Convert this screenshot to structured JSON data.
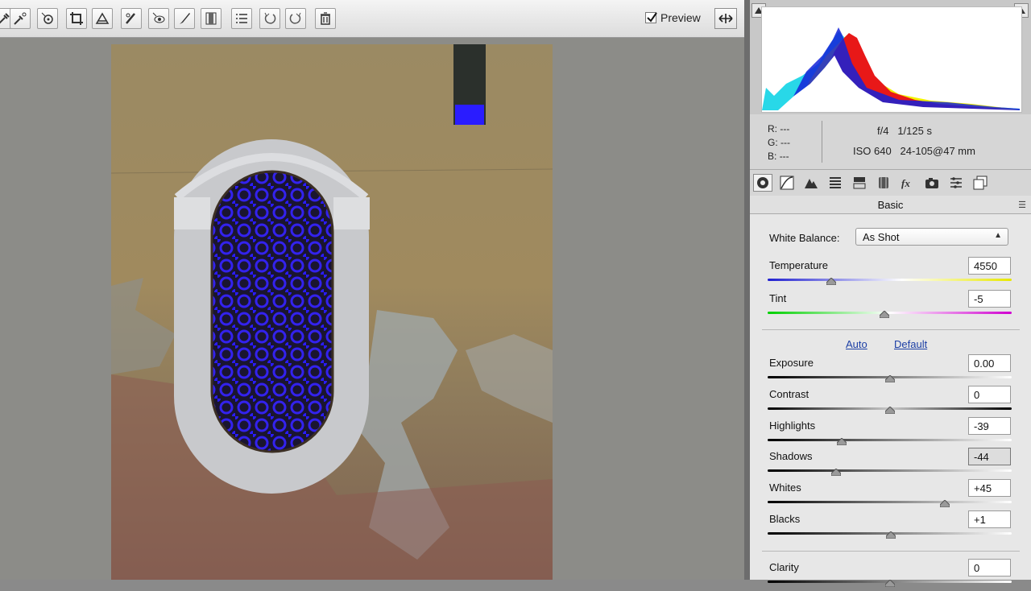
{
  "toolbar": {
    "tools": [
      "white-balance-tool",
      "color-sampler-tool",
      "targeted-adjustment-tool",
      "crop-tool",
      "straighten-tool",
      "spot-removal-tool",
      "red-eye-tool",
      "adjustment-brush-tool",
      "graduated-filter-tool",
      "preferences-button",
      "rotate-ccw-button",
      "rotate-cw-button",
      "delete-button"
    ],
    "preview_label": "Preview",
    "preview_checked": true
  },
  "info": {
    "r_label": "R:",
    "r_value": "---",
    "g_label": "G:",
    "g_value": "---",
    "b_label": "B:",
    "b_value": "---",
    "aperture": "f/4",
    "shutter": "1/125 s",
    "iso": "ISO 640",
    "lens": "24-105@47 mm"
  },
  "panel": {
    "section_title": "Basic",
    "white_balance_label": "White Balance:",
    "white_balance_value": "As Shot",
    "auto_label": "Auto",
    "default_label": "Default",
    "sliders": [
      {
        "label": "Temperature",
        "value": "4550",
        "position": 0.26
      },
      {
        "label": "Tint",
        "value": "-5",
        "position": 0.48
      },
      {
        "label": "Exposure",
        "value": "0.00",
        "position": 0.5
      },
      {
        "label": "Contrast",
        "value": "0",
        "position": 0.5
      },
      {
        "label": "Highlights",
        "value": "-39",
        "position": 0.305
      },
      {
        "label": "Shadows",
        "value": "-44",
        "position": 0.28
      },
      {
        "label": "Whites",
        "value": "+45",
        "position": 0.725
      },
      {
        "label": "Blacks",
        "value": "+1",
        "position": 0.505
      },
      {
        "label": "Clarity",
        "value": "0",
        "position": 0.5
      }
    ]
  },
  "colors": {
    "accent_link": "#1c3fa5",
    "clipping_blue": "#2a1cff"
  }
}
